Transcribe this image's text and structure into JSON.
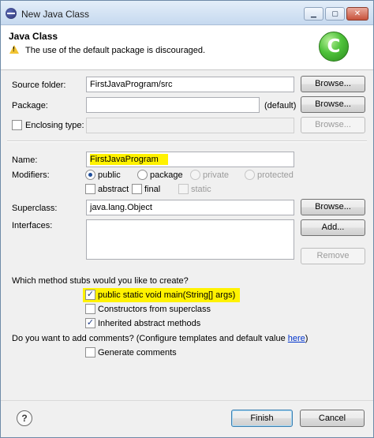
{
  "window": {
    "title": "New Java Class",
    "controls": {
      "minimize": "▁",
      "maximize": "▢",
      "close": "✕"
    }
  },
  "header": {
    "title": "Java Class",
    "warning": "The use of the default package is discouraged.",
    "logo_letter": "C",
    "icon": "warning-triangle-icon"
  },
  "form": {
    "source_folder": {
      "label": "Source folder:",
      "value": "FirstJavaProgram/src",
      "button": "Browse..."
    },
    "package": {
      "label": "Package:",
      "value": "",
      "suffix": "(default)",
      "button": "Browse..."
    },
    "enclosing_type": {
      "label": "Enclosing type:",
      "checked": false,
      "value": "",
      "button": "Browse..."
    },
    "name": {
      "label": "Name:",
      "value": "FirstJavaProgram"
    },
    "modifiers": {
      "label": "Modifiers:",
      "access": [
        "public",
        "package",
        "private",
        "protected"
      ],
      "selected": "public",
      "flags": [
        "abstract",
        "final",
        "static"
      ]
    },
    "superclass": {
      "label": "Superclass:",
      "value": "java.lang.Object",
      "button": "Browse..."
    },
    "interfaces": {
      "label": "Interfaces:",
      "add_button": "Add...",
      "remove_button": "Remove"
    },
    "stubs": {
      "question": "Which method stubs would you like to create?",
      "main": "public static void main(String[] args)",
      "constructors": "Constructors from superclass",
      "inherited": "Inherited abstract methods",
      "main_checked": true,
      "constructors_checked": false,
      "inherited_checked": true
    },
    "comments": {
      "question_prefix": "Do you want to add comments? (Configure templates and default value ",
      "link": "here",
      "question_suffix": ")",
      "generate": "Generate comments",
      "generate_checked": false
    }
  },
  "footer": {
    "help": "?",
    "finish": "Finish",
    "cancel": "Cancel"
  },
  "colors": {
    "highlight": "#fff200",
    "link": "#0033cc",
    "logo": "#4ec23a"
  }
}
